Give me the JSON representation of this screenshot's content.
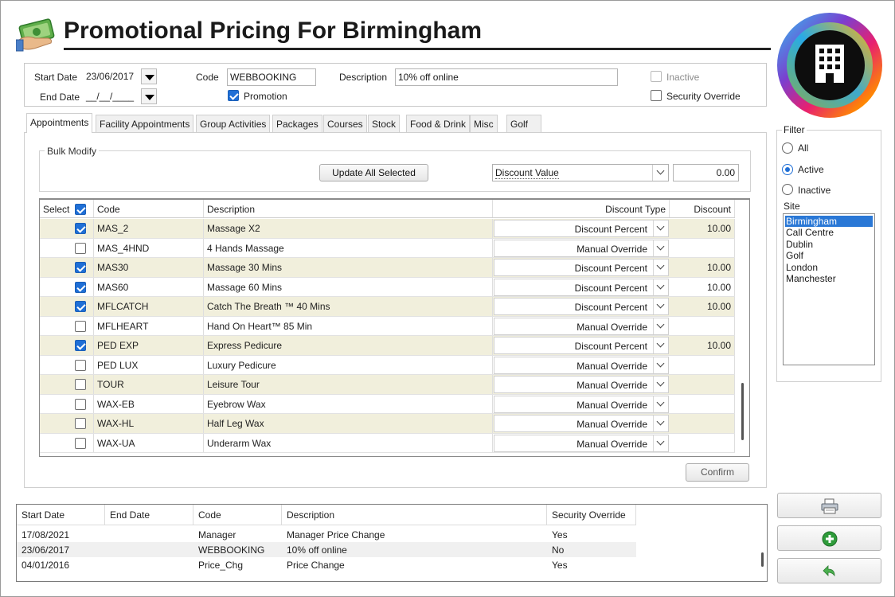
{
  "header": {
    "title": "Promotional Pricing For Birmingham"
  },
  "promo": {
    "start_date_label": "Start Date",
    "start_date": "23/06/2017",
    "end_date_label": "End Date",
    "end_date": "__/__/____",
    "code_label": "Code",
    "code": "WEBBOOKING",
    "description_label": "Description",
    "description": "10% off online",
    "promotion_label": "Promotion",
    "promotion_checked": true,
    "inactive_label": "Inactive",
    "security_override_label": "Security Override"
  },
  "tabs": [
    {
      "label": "Appointments",
      "active": true
    },
    {
      "label": "Facility Appointments"
    },
    {
      "label": "Group Activities"
    },
    {
      "label": "Packages"
    },
    {
      "label": "Courses"
    },
    {
      "label": "Stock"
    },
    {
      "label": "Food & Drink"
    },
    {
      "label": "Misc"
    },
    {
      "label": "Golf"
    }
  ],
  "bulk": {
    "legend": "Bulk Modify",
    "update_button": "Update All Selected",
    "discount_type": "Discount Value",
    "value": "0.00"
  },
  "grid": {
    "columns": {
      "select": "Select",
      "code": "Code",
      "description": "Description",
      "discount_type": "Discount Type",
      "discount": "Discount"
    },
    "rows": [
      {
        "checked": true,
        "code": "MAS_2",
        "description": "Massage X2",
        "type": "Discount Percent",
        "discount": "10.00",
        "alt": true
      },
      {
        "checked": false,
        "code": "MAS_4HND",
        "description": "4 Hands Massage",
        "type": "Manual Override",
        "discount": "",
        "alt": false
      },
      {
        "checked": true,
        "code": "MAS30",
        "description": "Massage 30 Mins",
        "type": "Discount Percent",
        "discount": "10.00",
        "alt": true
      },
      {
        "checked": true,
        "code": "MAS60",
        "description": "Massage 60 Mins",
        "type": "Discount Percent",
        "discount": "10.00",
        "alt": false
      },
      {
        "checked": true,
        "code": "MFLCATCH",
        "description": "Catch The Breath ™ 40 Mins",
        "type": "Discount Percent",
        "discount": "10.00",
        "alt": true
      },
      {
        "checked": false,
        "code": "MFLHEART",
        "description": "Hand On Heart™ 85 Min",
        "type": "Manual Override",
        "discount": "",
        "alt": false
      },
      {
        "checked": true,
        "code": "PED EXP",
        "description": "Express Pedicure",
        "type": "Discount Percent",
        "discount": "10.00",
        "alt": true
      },
      {
        "checked": false,
        "code": "PED LUX",
        "description": "Luxury Pedicure",
        "type": "Manual Override",
        "discount": "",
        "alt": false
      },
      {
        "checked": false,
        "code": "TOUR",
        "description": "Leisure Tour",
        "type": "Manual Override",
        "discount": "",
        "alt": true
      },
      {
        "checked": false,
        "code": "WAX-EB",
        "description": "Eyebrow Wax",
        "type": "Manual Override",
        "discount": "",
        "alt": false
      },
      {
        "checked": false,
        "code": "WAX-HL",
        "description": "Half Leg Wax",
        "type": "Manual Override",
        "discount": "",
        "alt": true
      },
      {
        "checked": false,
        "code": "WAX-UA",
        "description": "Underarm Wax",
        "type": "Manual Override",
        "discount": "",
        "alt": false
      }
    ]
  },
  "confirm_button": "Confirm",
  "filter": {
    "legend": "Filter",
    "options": [
      {
        "label": "All",
        "selected": false
      },
      {
        "label": "Active",
        "selected": true
      },
      {
        "label": "Inactive",
        "selected": false
      }
    ],
    "site_label": "Site",
    "sites": [
      {
        "label": "Birmingham",
        "selected": true
      },
      {
        "label": "Call Centre"
      },
      {
        "label": "Dublin"
      },
      {
        "label": "Golf"
      },
      {
        "label": "London"
      },
      {
        "label": "Manchester"
      }
    ]
  },
  "promotions_list": {
    "columns": {
      "start_date": "Start Date",
      "end_date": "End Date",
      "code": "Code",
      "description": "Description",
      "security_override": "Security Override"
    },
    "rows": [
      {
        "start_date": "17/08/2021",
        "end_date": "",
        "code": "Manager",
        "description": "Manager Price Change",
        "security_override": "Yes",
        "selected": false
      },
      {
        "start_date": "23/06/2017",
        "end_date": "",
        "code": "WEBBOOKING",
        "description": "10% off online",
        "security_override": "No",
        "selected": true
      },
      {
        "start_date": "04/01/2016",
        "end_date": "",
        "code": "Price_Chg",
        "description": "Price Change",
        "security_override": "Yes",
        "selected": false
      }
    ]
  },
  "icons": {
    "print": "printer-icon",
    "add": "add-icon",
    "undo": "undo-icon"
  },
  "colors": {
    "accent": "#1f6fd6",
    "row_alt": "#f1efdc",
    "title": "#1a1a1a"
  }
}
